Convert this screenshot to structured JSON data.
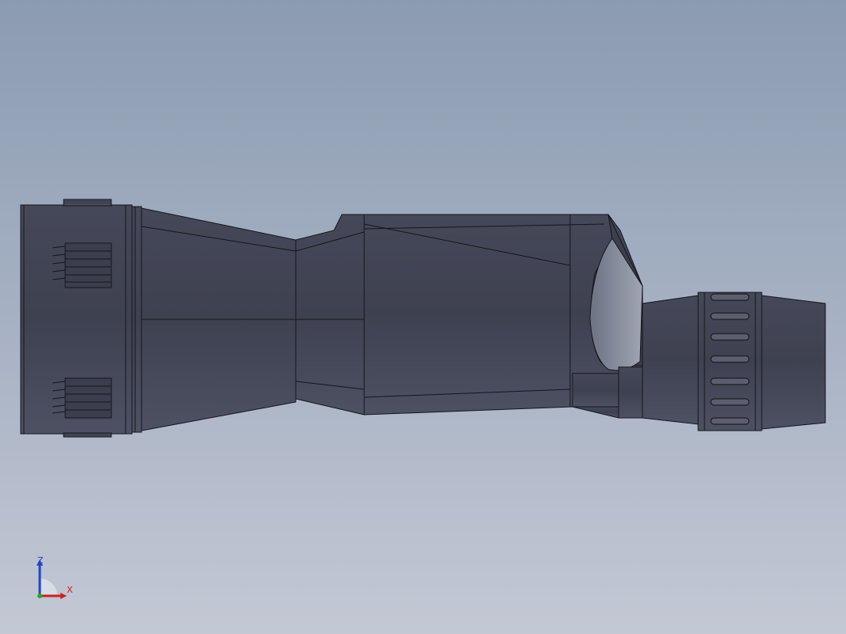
{
  "viewport": {
    "background_top": "#8b9bb1",
    "background_bottom": "#c3c8d4",
    "model": {
      "body_color": "#3f4250",
      "edge_color": "#1a1b22",
      "highlight_color": "#6c7080",
      "eyecup_inner_color": "#8e93a2"
    }
  },
  "triad": {
    "z_label": "Z",
    "x_label": "X",
    "z_color": "#2244cc",
    "x_color": "#cc2222",
    "y_color": "#22aa22"
  }
}
